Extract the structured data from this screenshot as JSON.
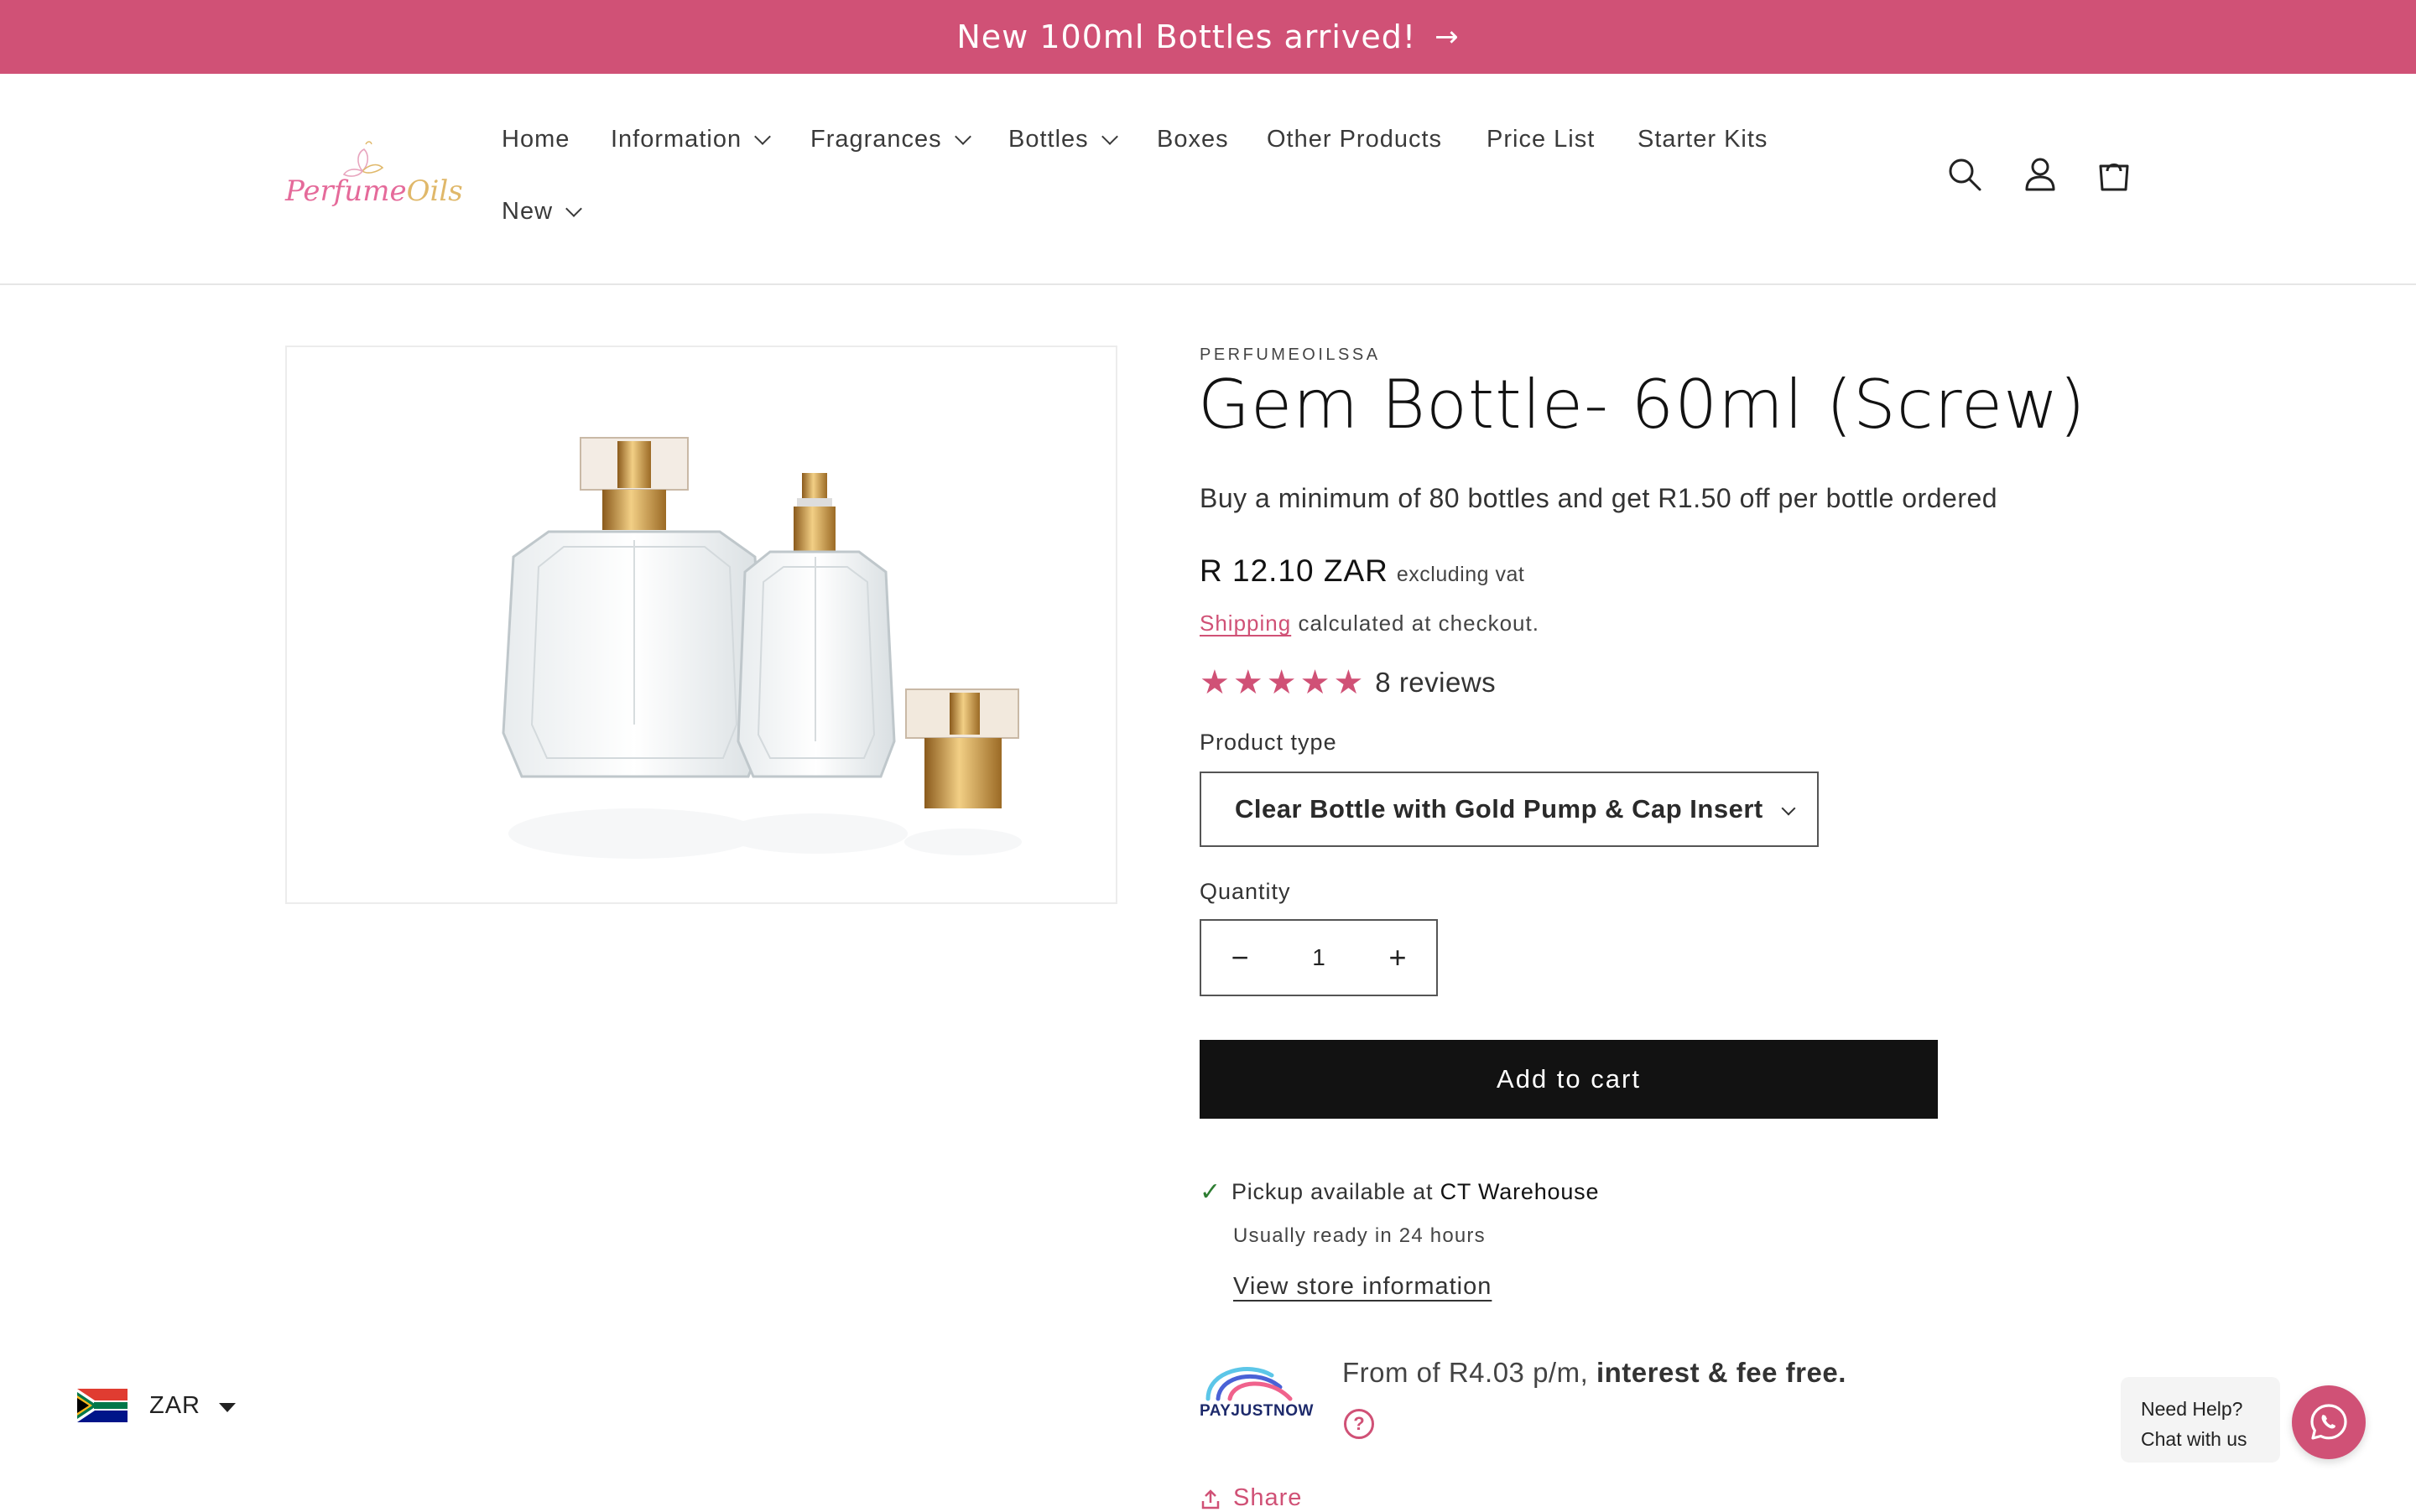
{
  "announcement": {
    "text": "New 100ml Bottles arrived!",
    "arrow": "→"
  },
  "logo": {
    "word1": "Perfume",
    "word2": "Oils"
  },
  "nav": {
    "items": [
      {
        "label": "Home"
      },
      {
        "label": "Information"
      },
      {
        "label": "Fragrances"
      },
      {
        "label": "Bottles"
      },
      {
        "label": "Boxes"
      },
      {
        "label": "Other Products"
      },
      {
        "label": "Price List"
      },
      {
        "label": "Starter Kits"
      },
      {
        "label": "New"
      }
    ]
  },
  "header_icons": [
    "search-icon",
    "account-icon",
    "cart-icon"
  ],
  "product": {
    "vendor": "PERFUMEOILSSA",
    "title": "Gem Bottle- 60ml (Screw)",
    "promo": "Buy a minimum of 80 bottles and get R1.50 off per bottle ordered",
    "price": "R 12.10 ZAR",
    "tax_note": "excluding vat",
    "shipping_link": "Shipping",
    "shipping_rest": "calculated at checkout.",
    "rating": 5,
    "reviews_label": "8 reviews",
    "product_type_label": "Product type",
    "product_type_value": "Clear Bottle with Gold Pump & Cap Insert",
    "quantity_label": "Quantity",
    "quantity_value": "1",
    "minus": "−",
    "plus": "+",
    "add_to_cart": "Add to cart"
  },
  "pickup": {
    "prefix": "Pickup available at",
    "location": "CT Warehouse",
    "ready": "Usually ready in 24 hours",
    "store_link": "View store information"
  },
  "payjustnow": {
    "logo_text": "PAYJUSTNOW",
    "text": "From of R4.03 p/m,",
    "bold": "interest & fee free.",
    "help": "?"
  },
  "share": {
    "label": "Share"
  },
  "currency": {
    "code": "ZAR"
  },
  "chat": {
    "line1": "Need Help?",
    "line2": "Chat with us"
  },
  "colors": {
    "accent": "#d05176",
    "button": "#121212",
    "check": "#2e7d32"
  }
}
